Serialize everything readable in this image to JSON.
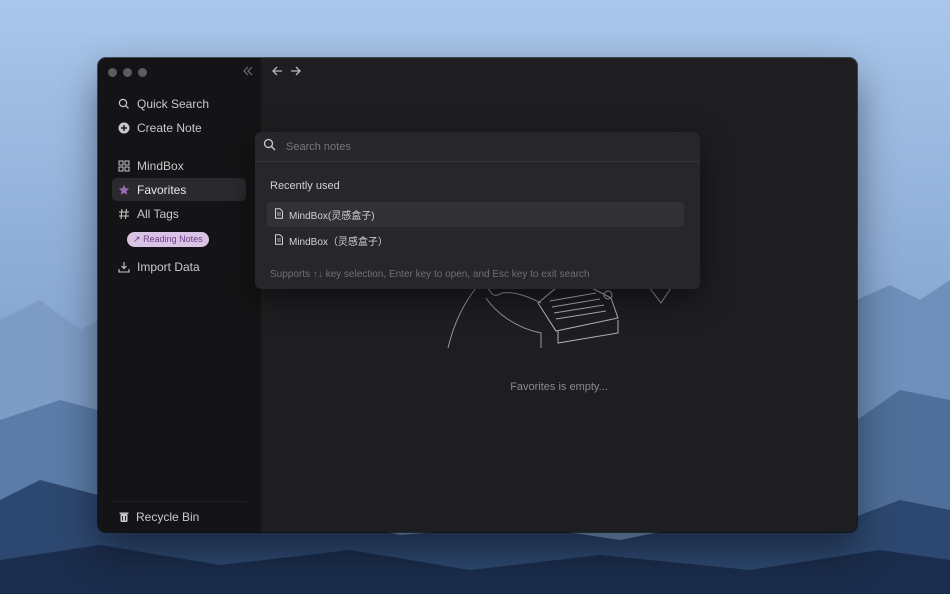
{
  "sidebar": {
    "items": [
      {
        "label": "Quick Search",
        "icon": "search-icon"
      },
      {
        "label": "Create Note",
        "icon": "plus-circle-icon"
      },
      {
        "label": "MindBox",
        "icon": "grid-icon"
      },
      {
        "label": "Favorites",
        "icon": "star-icon",
        "active": true
      },
      {
        "label": "All Tags",
        "icon": "hash-icon"
      },
      {
        "label": "Import Data",
        "icon": "import-icon"
      }
    ],
    "tag": "Reading Notes",
    "recycle_bin": "Recycle Bin"
  },
  "main": {
    "empty_text": "Favorites is empty..."
  },
  "search": {
    "placeholder": "Search notes",
    "section_title": "Recently used",
    "results": [
      {
        "title": "MindBox(灵感盒子)"
      },
      {
        "title": "MindBox（灵感盒子）"
      }
    ],
    "hint": "Supports ↑↓ key selection, Enter key to open, and Esc key to exit search"
  },
  "colors": {
    "accent": "#9b6bb8",
    "tag_bg": "#d9c4e6",
    "sidebar_bg": "#141416",
    "main_bg": "#1e1e21"
  }
}
